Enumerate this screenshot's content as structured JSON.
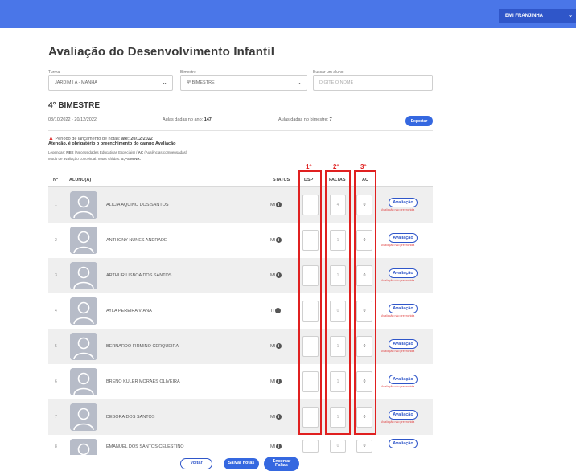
{
  "topbar": {
    "user_name": "EMI FRANJINHA",
    "chevron_icon": "chevron-down-icon"
  },
  "page": {
    "title": "Avaliação do Desenvolvimento Infantil"
  },
  "filters": {
    "turma_label": "Turma",
    "turma_value": "JARDIM I A - MANHÃ",
    "bimestre_label": "Bimestre",
    "bimestre_value": "4º BIMESTRE",
    "search_label": "Buscar um aluno",
    "search_placeholder": "DIGITE O NOME"
  },
  "summary": {
    "title": "4° BIMESTRE",
    "period": "03/10/2022 - 20/12/2022",
    "aulas_ano_label": "Aulas dadas no ano:",
    "aulas_ano_value": "147",
    "aulas_bim_label": "Aulas dadas no bimestre:",
    "aulas_bim_value": "7",
    "export_label": "Exportar"
  },
  "notices": {
    "period_text": "Período de lançamento de notas:",
    "period_deadline": "até: 20/12/2022",
    "attention": "Atenção, é obrigatório o preenchimento do campo Avaliação",
    "legend_label": "Legendas:",
    "legend_nee": "NEE",
    "legend_nee_desc": "(Necessidades Educativas Especiais) /",
    "legend_ac": "AC",
    "legend_ac_desc": "(Ausências compensadas)",
    "legend2_text": "Modo de avaliação conceitual: notas válidas:",
    "legend2_values": "S,PS,M,NR."
  },
  "table": {
    "headers": {
      "num": "Nº",
      "aluno": "ALUNO(A)",
      "status": "STATUS",
      "dsp": "DSP",
      "faltas": "FALTAS",
      "ac": "AC"
    },
    "eval_button": "Avaliação",
    "eval_note": "Avaliação não preenchida",
    "rows": [
      {
        "num": "1",
        "name": "ALICIA AQUINO DOS SANTOS",
        "status": "MI",
        "faltas": "4",
        "ac": "0",
        "note": "Avaliação não preenchida"
      },
      {
        "num": "2",
        "name": "ANTHONY NUNES ANDRADE",
        "status": "MI",
        "faltas": "1",
        "ac": "0",
        "note": "Avaliação não preenchida"
      },
      {
        "num": "3",
        "name": "ARTHUR LISBOA DOS SANTOS",
        "status": "MI",
        "faltas": "1",
        "ac": "0",
        "note": "Avaliação não preenchida"
      },
      {
        "num": "4",
        "name": "AYLA PEREIRA VIANA",
        "status": "TI",
        "faltas": "0",
        "ac": "0",
        "note": "Avaliação não preenchida"
      },
      {
        "num": "5",
        "name": "BERNARDO FIRMINO CERQUEIRA",
        "status": "MI",
        "faltas": "1",
        "ac": "0",
        "note": "Avaliação não preenchida"
      },
      {
        "num": "6",
        "name": "BRENO KULER MORAES OLIVEIRA",
        "status": "MI",
        "faltas": "1",
        "ac": "0",
        "note": "Avaliação não preenchida"
      },
      {
        "num": "7",
        "name": "DEBORA DOS SANTOS",
        "status": "MI",
        "faltas": "1",
        "ac": "0",
        "note": "Avaliação não preenchida"
      },
      {
        "num": "8",
        "name": "EMANUEL DOS SANTOS CELESTINO",
        "status": "MI",
        "faltas": "0",
        "ac": "0",
        "note": ""
      }
    ]
  },
  "annotations": {
    "label1": "1º",
    "label2": "2º",
    "label3": "3º",
    "color": "#e02020"
  },
  "bottom": {
    "voltar": "Voltar",
    "salvar": "Salvar notas",
    "encerrar_line1": "Encerrar",
    "encerrar_line2": "Faltas"
  },
  "colors": {
    "topbar": "#4a76e8",
    "primary": "#3568e0",
    "row_shade": "#efefef"
  }
}
